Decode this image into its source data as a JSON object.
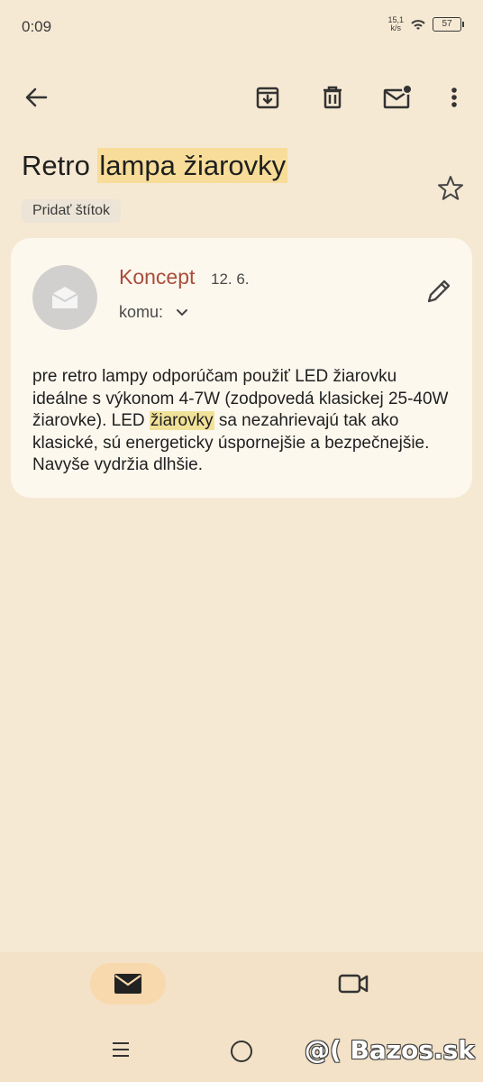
{
  "status_bar": {
    "time": "0:09",
    "net_speed_value": "15,1",
    "net_speed_unit": "k/s",
    "battery": "57"
  },
  "toolbar": {
    "back_icon": "arrow-left-icon",
    "archive_icon": "archive-icon",
    "delete_icon": "trash-icon",
    "mark_unread_icon": "mail-unread-icon",
    "more_icon": "more-vert-icon"
  },
  "email": {
    "subject_plain": "Retro ",
    "subject_highlight": "lampa žiarovky",
    "add_label": "Pridať štítok",
    "sender": "Koncept",
    "date": "12. 6.",
    "to_label": "komu:",
    "body_part1": "pre retro lampy odporúčam použiť LED žiarovku ideálne s výkonom 4-7W (zodpovedá klasickej 25-40W žiarovke). LED ",
    "body_highlight": "žiarovky",
    "body_part2": " sa nezahrievajú tak ako klasické, sú energeticky úspornejšie a bezpečnejšie. Navyše vydržia dlhšie."
  },
  "bottom_nav": {
    "mail_icon": "mail-icon",
    "video_icon": "video-icon"
  },
  "watermark": "@( Bazos.sk",
  "colors": {
    "background": "#f6e9d3",
    "card": "#fdf8ee",
    "highlight": "#f7dd99",
    "sender": "#a94d3c",
    "nav_active": "#f8d9ad"
  }
}
